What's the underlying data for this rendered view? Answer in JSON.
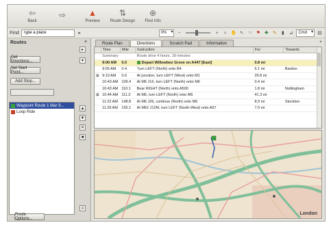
{
  "toolbar": {
    "buttons": [
      {
        "label": "Back",
        "icon": "back-arrow-icon",
        "glyph": "⇦",
        "active": false
      },
      {
        "label": "",
        "icon": "forward-arrow-icon",
        "glyph": "⇨",
        "active": false
      },
      {
        "label": "Preview",
        "icon": "preview-icon",
        "glyph": "▲",
        "active": true
      },
      {
        "label": "Route Design",
        "icon": "route-design-icon",
        "glyph": "⇅",
        "active": false
      },
      {
        "label": "Find Info",
        "icon": "find-info-icon",
        "glyph": "⊕",
        "active": false
      }
    ]
  },
  "findbar": {
    "find_label": "Find",
    "find_value": "Type a place",
    "zoom_value": "0%",
    "units_value": "Cmd",
    "accent": "#d2431c"
  },
  "sidebar": {
    "title": "Routes",
    "buttons": [
      "Get Directions...",
      "Set Start Point...",
      "Add Stop..."
    ],
    "items": [
      {
        "label": "Waypoint Route 1 Mar 9...",
        "color": "#3aa040",
        "selected": true
      },
      {
        "label": "Loop Ride",
        "color": "#c8402a",
        "selected": false
      }
    ],
    "bottom_button": "Route Options..."
  },
  "tabs": {
    "items": [
      {
        "label": "Route Plan",
        "active": false
      },
      {
        "label": "Directions",
        "active": true
      },
      {
        "label": "Scratch Pad",
        "active": false
      },
      {
        "label": "Information",
        "active": false
      }
    ]
  },
  "table": {
    "headers": [
      "",
      "Time",
      "Mile",
      "Instruction",
      "For",
      "Towards"
    ],
    "rows": [
      {
        "type": "group",
        "cells": [
          "",
          "Summary",
          "",
          "Route drive 4 hours, 18 minutes",
          "",
          ""
        ]
      },
      {
        "type": "hl",
        "cells": [
          "",
          "9:00 AM",
          "0.0",
          "Depart Willowbee Grove on A447 [East]",
          "0.8 mi",
          ""
        ]
      },
      {
        "type": "row",
        "cells": [
          "",
          "9:05 AM",
          "0.4",
          "Turn LEFT (North) onto B4",
          "6.1 mi",
          "Bardon"
        ]
      },
      {
        "type": "row",
        "cells": [
          "⊞",
          "9:10 AM",
          "0.6",
          "At junction, turn LEFT (West) onto M1",
          "29.8 mi",
          ""
        ]
      },
      {
        "type": "row",
        "cells": [
          "",
          "10:43 AM",
          "109.4",
          "At M6 J16, turn LEFT (North) onto M6",
          "0.4 mi",
          ""
        ]
      },
      {
        "type": "row",
        "cells": [
          "",
          "10:43 AM",
          "110.1",
          "Bear RIGHT (North) onto A500",
          "1.8 mi",
          "Nottingham"
        ]
      },
      {
        "type": "row",
        "cells": [
          "⊞",
          "10:44 AM",
          "111.3",
          "At M6, turn LEFT (North) onto M6",
          "41.3 mi",
          ""
        ]
      },
      {
        "type": "row",
        "cells": [
          "",
          "11:22 AM",
          "148.8",
          "At M6 J26, continue (North) onto M6",
          "8.9 mi",
          "Stockton"
        ]
      },
      {
        "type": "row",
        "cells": [
          "",
          "11:29 AM",
          "155.1",
          "At M62 J12M, turn LEFT (North-West) onto A57",
          "7.0 mi",
          ""
        ]
      }
    ]
  },
  "map": {
    "city_label": "London"
  }
}
